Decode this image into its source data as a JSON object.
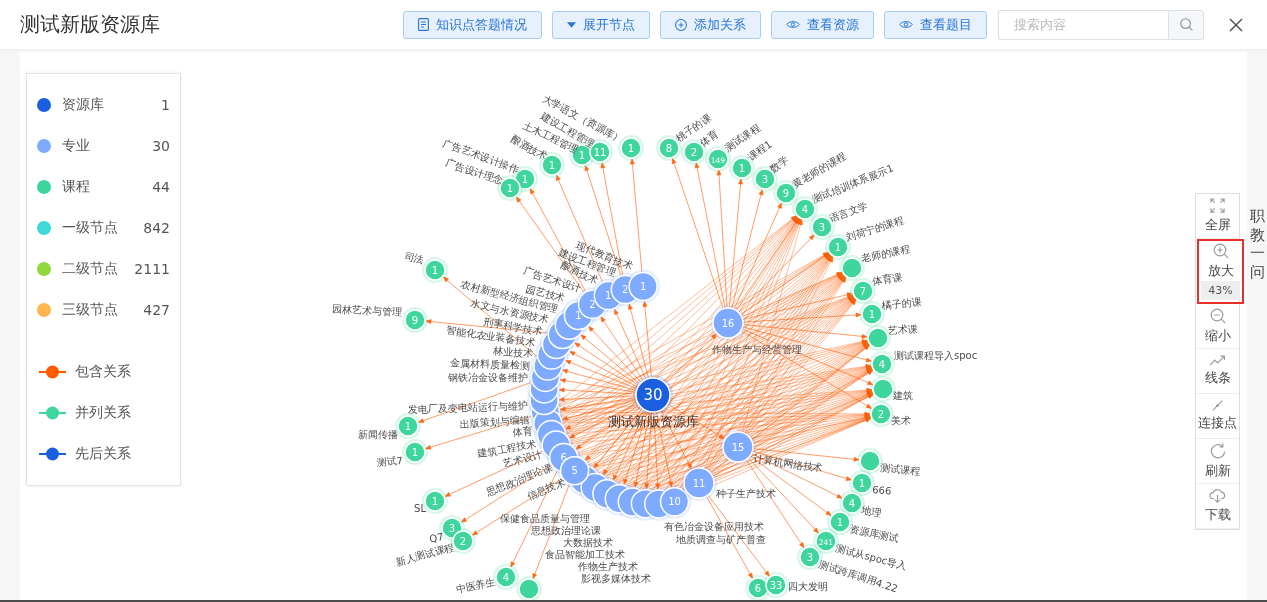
{
  "header": {
    "title": "测试新版资源库",
    "actions": [
      {
        "label": "知识点答题情况",
        "kind": "report"
      },
      {
        "label": "展开节点",
        "kind": "expand"
      },
      {
        "label": "添加关系",
        "kind": "add"
      },
      {
        "label": "查看资源",
        "kind": "view"
      },
      {
        "label": "查看题目",
        "kind": "view"
      }
    ],
    "search": {
      "placeholder": "搜索内容"
    }
  },
  "legend": {
    "categories": [
      {
        "label": "资源库",
        "count": "1",
        "color": "#1a5fe0"
      },
      {
        "label": "专业",
        "count": "30",
        "color": "#7eaaff"
      },
      {
        "label": "课程",
        "count": "44",
        "color": "#3ed69c"
      },
      {
        "label": "一级节点",
        "count": "842",
        "color": "#3ed9d9"
      },
      {
        "label": "二级节点",
        "count": "2111",
        "color": "#8fd93f"
      },
      {
        "label": "三级节点",
        "count": "427",
        "color": "#ffb64d"
      }
    ],
    "relations": [
      {
        "label": "包含关系",
        "color": "#ff5a00"
      },
      {
        "label": "并列关系",
        "color": "#3ed69c"
      },
      {
        "label": "先后关系",
        "color": "#1a5fe0"
      }
    ]
  },
  "graph": {
    "root": {
      "label": "测试新版资源库",
      "count": "30"
    },
    "majors": [
      {
        "label": "现代教育技术",
        "count": "1",
        "courses": [
          {
            "label": "大学语文（资源库）",
            "count": "1",
            "shared": false
          }
        ]
      },
      {
        "label": "建设工程管理",
        "count": "2",
        "courses": [
          {
            "label": "土木工程管理",
            "count": "1",
            "shared": false
          },
          {
            "label": "建设工程管理",
            "count": "11",
            "shared": false
          }
        ]
      },
      {
        "label": "酿酒技术",
        "count": "1",
        "courses": [
          {
            "label": "酿酒技术",
            "count": "1",
            "shared": false
          }
        ]
      },
      {
        "label": "广告艺术设计",
        "count": "2",
        "courses": [
          {
            "label": "广告艺术设计操作",
            "count": "1",
            "shared": false
          },
          {
            "label": "广告设计理念",
            "count": "1",
            "shared": false
          }
        ]
      },
      {
        "label": "园艺技术",
        "count": "1"
      },
      {
        "label": "农村新型经济组织管理"
      },
      {
        "label": "水文与水资源技术",
        "courses": [
          {
            "label": "园林艺术与管理",
            "count": "9",
            "shared": false
          }
        ]
      },
      {
        "label": "刑事科学技术"
      },
      {
        "label": "智能化农业装备技术"
      },
      {
        "label": "林业技术",
        "courses": [
          {
            "label": "司法",
            "count": "1",
            "shared": false
          }
        ]
      },
      {
        "label": "金属材料质量检测",
        "courses": [
          {
            "label": "新闻传播",
            "count": "1",
            "shared": false
          }
        ]
      },
      {
        "label": "钢铁冶金设备维护"
      },
      {
        "label": "发电厂及变电站运行与维护"
      },
      {
        "label": "出版策划与编辑",
        "courses": [
          {
            "label": "测试7",
            "count": "1",
            "shared": false
          }
        ]
      },
      {
        "label": "体育"
      },
      {
        "label": "建筑工程技术"
      },
      {
        "label": "艺术设计",
        "courses": [
          {
            "label": "SL",
            "count": "1",
            "shared": false
          }
        ]
      },
      {
        "label": "思想政治理论课",
        "count": "6",
        "courses": [
          {
            "label": "Q7",
            "count": "3",
            "shared": false
          },
          {
            "label": "中医养生",
            "count": "4",
            "shared": false
          }
        ]
      },
      {
        "label": "信息技术",
        "count": "5",
        "courses": [
          {
            "label": "新人测试课程",
            "count": "2",
            "shared": false
          },
          {
            "shared": false
          }
        ]
      },
      {
        "label": "保健食品质量与管理"
      },
      {
        "label": "思想政治理论课"
      },
      {
        "label": "大数据技术"
      },
      {
        "label": "食品智能加工技术"
      },
      {
        "label": "作物生产技术"
      },
      {
        "label": "影视多媒体技术"
      },
      {
        "label": "有色冶金设备应用技术"
      },
      {
        "label": "地质调查与矿产普查",
        "count": "10"
      },
      {
        "label": "作物生产与经营管理",
        "count": "16",
        "courses": [
          {
            "label": "桃子的课",
            "count": "8",
            "shared": false
          },
          {
            "label": "体育",
            "count": "2",
            "shared": false
          },
          {
            "label": "测试课程",
            "count": "149",
            "shared": false
          },
          {
            "label": "课程1",
            "count": "1",
            "shared": false
          },
          {
            "label": "数学",
            "count": "3",
            "shared": false
          },
          {
            "label": "黄老师的课程",
            "count": "9",
            "shared": false
          },
          {
            "label": "测试培训体系展示1",
            "count": "4",
            "shared": true
          },
          {
            "label": "语言文学",
            "count": "3",
            "shared": false
          },
          {
            "label": "刘荷宁的课程",
            "count": "1",
            "shared": true
          },
          {
            "label": "老师的课程",
            "shared": true
          },
          {
            "label": "体育课",
            "count": "7",
            "shared": true
          },
          {
            "label": "橘子的课",
            "count": "1",
            "shared": false
          },
          {
            "label": "艺术课",
            "shared": true
          },
          {
            "label": "测试课程导入spoc",
            "count": "4",
            "shared": true
          },
          {
            "label": "建筑",
            "shared": true
          },
          {
            "label": "美术",
            "count": "2",
            "shared": true
          }
        ]
      },
      {
        "label": "计算机网络技术",
        "count": "15",
        "courses": [
          {
            "label": "测试课程",
            "shared": false
          },
          {
            "label": "666",
            "count": "1",
            "shared": false
          },
          {
            "label": "地理",
            "count": "4",
            "shared": false
          },
          {
            "label": "资源库测试",
            "count": "1",
            "shared": false
          },
          {
            "label": "测试从spoc导入",
            "count": "241",
            "shared": false
          },
          {
            "label": "测试跨库调用4.22",
            "count": "3",
            "shared": false
          }
        ]
      },
      {
        "label": "种子生产技术",
        "count": "11",
        "courses": [
          {
            "count": "6",
            "shared": false
          },
          {
            "label": "四大发明",
            "count": "33",
            "shared": false
          }
        ]
      }
    ]
  },
  "toolbar": [
    {
      "label": "全屏",
      "kind": "fullscreen",
      "highlighted": false
    },
    {
      "label": "放大",
      "kind": "zoom_in",
      "reading": "43%",
      "highlighted": true
    },
    {
      "label": "缩小",
      "kind": "zoom_out",
      "highlighted": false
    },
    {
      "label": "线条",
      "kind": "lines",
      "highlighted": false
    },
    {
      "label": "连接点",
      "kind": "connect",
      "highlighted": false
    },
    {
      "label": "刷新",
      "kind": "refresh",
      "highlighted": false
    },
    {
      "label": "下载",
      "kind": "download",
      "highlighted": false
    }
  ],
  "side_text": "职教一问"
}
